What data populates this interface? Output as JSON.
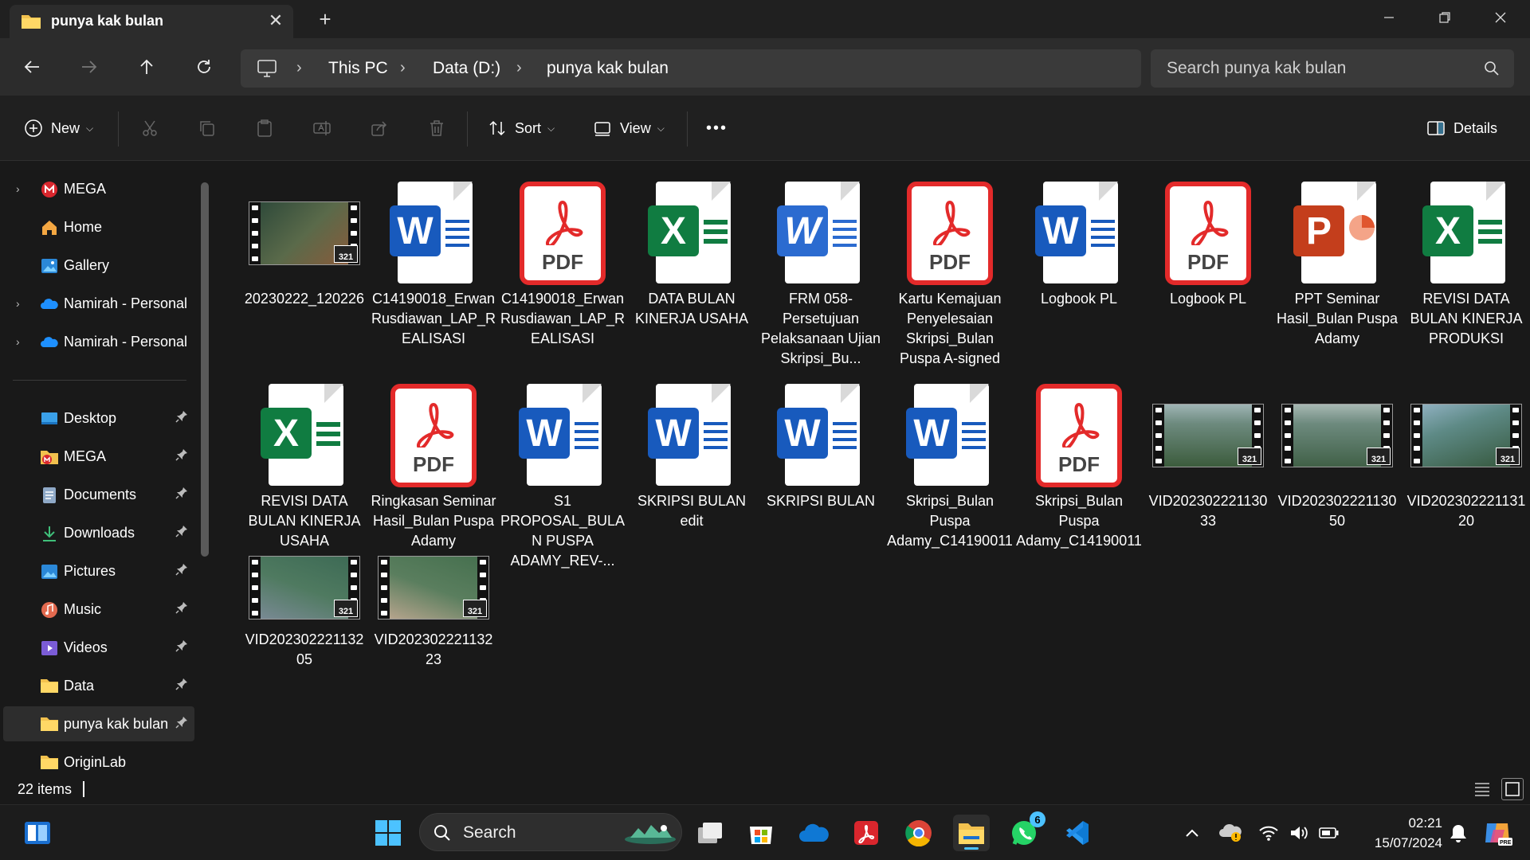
{
  "window": {
    "tab_title": "punya kak bulan",
    "new_tab_glyph": "+",
    "close_glyph": "✕"
  },
  "address": {
    "crumbs": [
      "This PC",
      "Data (D:)",
      "punya kak bulan"
    ],
    "search_placeholder": "Search punya kak bulan"
  },
  "toolbar": {
    "new_label": "New",
    "sort_label": "Sort",
    "view_label": "View",
    "more_label": "•••",
    "details_label": "Details"
  },
  "sidebar": {
    "items": [
      {
        "label": "MEGA",
        "icon": "mega-icon"
      },
      {
        "label": "Home",
        "icon": "home-icon"
      },
      {
        "label": "Gallery",
        "icon": "gallery-icon"
      },
      {
        "label": "Namirah - Personal",
        "icon": "onedrive-icon"
      },
      {
        "label": "Namirah - Personal",
        "icon": "onedrive-icon"
      },
      {
        "label": "Desktop",
        "icon": "desktop-icon"
      },
      {
        "label": "MEGA",
        "icon": "mega-folder-icon"
      },
      {
        "label": "Documents",
        "icon": "documents-icon"
      },
      {
        "label": "Downloads",
        "icon": "downloads-icon"
      },
      {
        "label": "Pictures",
        "icon": "pictures-icon"
      },
      {
        "label": "Music",
        "icon": "music-icon"
      },
      {
        "label": "Videos",
        "icon": "videos-icon"
      },
      {
        "label": "Data",
        "icon": "folder-icon"
      },
      {
        "label": "punya kak bulan",
        "icon": "folder-icon"
      },
      {
        "label": "OriginLab",
        "icon": "folder-icon"
      }
    ]
  },
  "files": [
    {
      "name": "20230222_120226",
      "type": "video"
    },
    {
      "name": "C14190018_Erwan Rusdiawan_LAP_REALISASI",
      "type": "word"
    },
    {
      "name": "C14190018_Erwan Rusdiawan_LAP_REALISASI",
      "type": "pdf"
    },
    {
      "name": "DATA BULAN KINERJA USAHA",
      "type": "excel"
    },
    {
      "name": "FRM 058-Persetujuan Pelaksanaan Ujian Skripsi_Bu...",
      "type": "word-old"
    },
    {
      "name": "Kartu Kemajuan Penyelesaian Skripsi_Bulan Puspa A-signed",
      "type": "pdf"
    },
    {
      "name": "Logbook PL",
      "type": "word"
    },
    {
      "name": "Logbook PL",
      "type": "pdf"
    },
    {
      "name": "PPT Seminar Hasil_Bulan Puspa Adamy",
      "type": "powerpoint"
    },
    {
      "name": "REVISI DATA BULAN KINERJA PRODUKSI",
      "type": "excel"
    },
    {
      "name": "REVISI DATA BULAN KINERJA USAHA",
      "type": "excel"
    },
    {
      "name": "Ringkasan Seminar Hasil_Bulan Puspa Adamy",
      "type": "pdf"
    },
    {
      "name": "S1 PROPOSAL_BULAN PUSPA ADAMY_REV-...",
      "type": "word"
    },
    {
      "name": "SKRIPSI BULAN edit",
      "type": "word"
    },
    {
      "name": "SKRIPSI BULAN",
      "type": "word"
    },
    {
      "name": "Skripsi_Bulan Puspa Adamy_C14190011",
      "type": "word"
    },
    {
      "name": "Skripsi_Bulan Puspa Adamy_C14190011",
      "type": "pdf"
    },
    {
      "name": "VID20230222113033",
      "type": "video"
    },
    {
      "name": "VID20230222113050",
      "type": "video"
    },
    {
      "name": "VID20230222113120",
      "type": "video"
    },
    {
      "name": "VID20230222113205",
      "type": "video"
    },
    {
      "name": "VID20230222113223",
      "type": "video"
    }
  ],
  "status": {
    "item_count": "22 items"
  },
  "taskbar": {
    "search_label": "Search",
    "whatsapp_badge": "6",
    "clock_time": "02:21",
    "clock_date": "15/07/2024"
  },
  "colors": {
    "word_blue": "#185abd",
    "excel_green": "#107c41",
    "pdf_red": "#e32a2a",
    "ppt_orange": "#c43e1c",
    "accent": "#4cc2ff"
  }
}
